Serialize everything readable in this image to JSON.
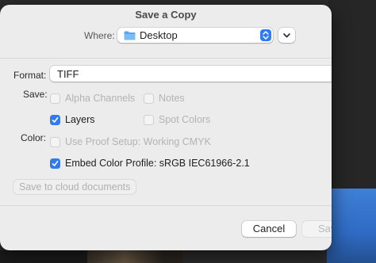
{
  "dialog": {
    "title": "Save a Copy",
    "where_label": "Where:",
    "where_value": "Desktop",
    "format_label": "Format:",
    "format_value": "TIFF",
    "save_label": "Save:",
    "color_label": "Color:",
    "options": {
      "alpha_channels": {
        "label": "Alpha Channels",
        "checked": false,
        "enabled": false
      },
      "notes": {
        "label": "Notes",
        "checked": false,
        "enabled": false
      },
      "layers": {
        "label": "Layers",
        "checked": true,
        "enabled": true
      },
      "spot_colors": {
        "label": "Spot Colors",
        "checked": false,
        "enabled": false
      },
      "use_proof_setup": {
        "label": "Use Proof Setup:  Working CMYK",
        "checked": false,
        "enabled": false
      },
      "embed_color_profile": {
        "label": "Embed Color Profile:  sRGB IEC61966-2.1",
        "checked": true,
        "enabled": true
      }
    },
    "cloud_button": "Save to cloud documents",
    "cancel_button": "Cancel",
    "save_button": "Sav"
  },
  "colors": {
    "accent": "#2f7bf5",
    "sheet": "#ececec"
  },
  "icons": {
    "where": "folder-icon",
    "stepper": "chevron-up-down-icon",
    "expand": "chevron-down-icon",
    "checkmark": "checkmark-icon"
  }
}
